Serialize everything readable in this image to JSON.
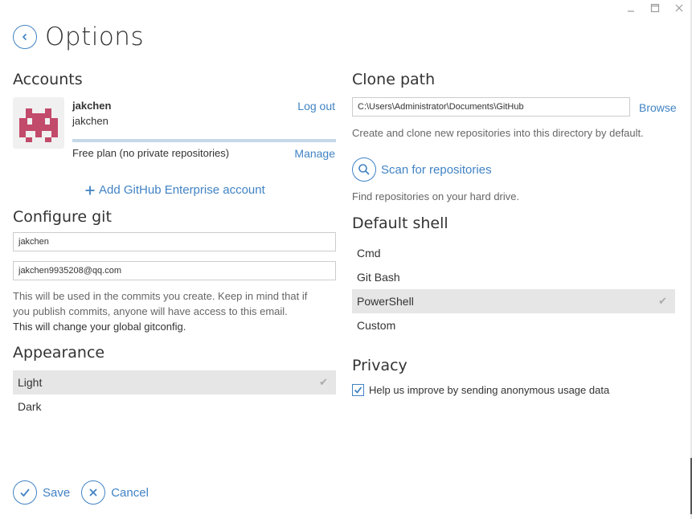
{
  "window": {
    "minimize_icon": "minimize-icon",
    "maximize_icon": "maximize-icon",
    "close_icon": "close-icon"
  },
  "header": {
    "title": "Options",
    "back_icon": "chevron-left-icon"
  },
  "accounts": {
    "heading": "Accounts",
    "name": "jakchen",
    "login": "jakchen",
    "logout_label": "Log out",
    "plan": "Free plan (no private repositories)",
    "manage_label": "Manage",
    "add_enterprise_label": "Add GitHub Enterprise account",
    "avatar_color": "#c24a6a"
  },
  "configure_git": {
    "heading": "Configure git",
    "name_value": "jakchen",
    "email_value": "jakchen9935208@qq.com",
    "help_line1": "This will be used in the commits you create. Keep in mind that if",
    "help_line2": "you publish commits, anyone will have access to this email.",
    "help_line3": "This will change your global gitconfig."
  },
  "appearance": {
    "heading": "Appearance",
    "options": [
      "Light",
      "Dark"
    ],
    "selected": "Light"
  },
  "clone_path": {
    "heading": "Clone path",
    "value": "C:\\Users\\Administrator\\Documents\\GitHub",
    "browse_label": "Browse",
    "description": "Create and clone new repositories into this directory by default.",
    "scan_label": "Scan for repositories",
    "scan_description": "Find repositories on your hard drive."
  },
  "default_shell": {
    "heading": "Default shell",
    "options": [
      "Cmd",
      "Git Bash",
      "PowerShell",
      "Custom"
    ],
    "selected": "PowerShell"
  },
  "privacy": {
    "heading": "Privacy",
    "checkbox_label": "Help us improve by sending anonymous usage data",
    "checked": true
  },
  "footer": {
    "save_label": "Save",
    "cancel_label": "Cancel"
  },
  "colors": {
    "accent": "#4183c4",
    "selected_bg": "#e6e6e6"
  }
}
